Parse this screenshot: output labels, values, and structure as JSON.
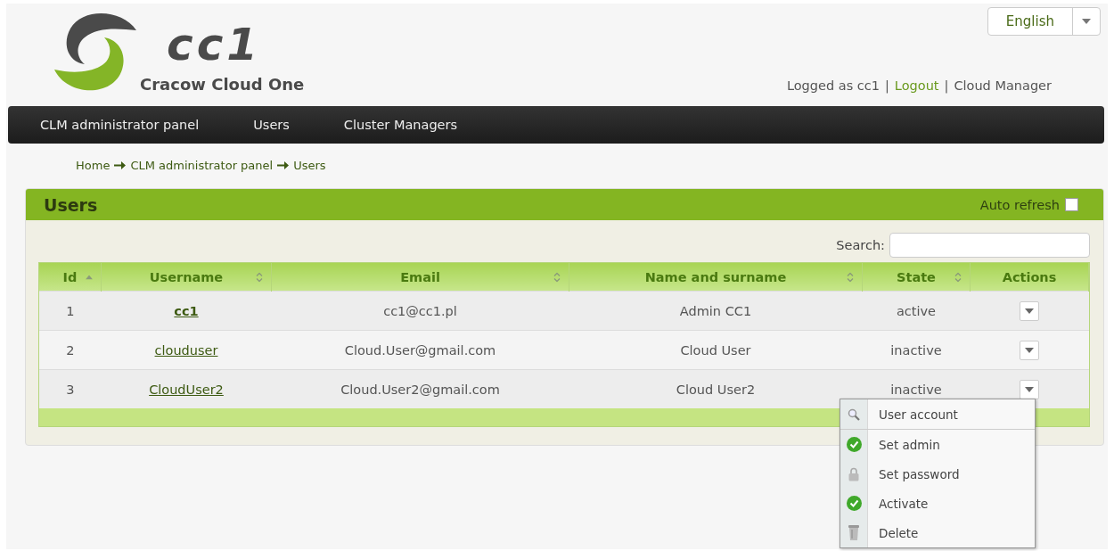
{
  "logo": {
    "name": "cc1",
    "tagline": "Cracow Cloud One"
  },
  "language": {
    "value": "English"
  },
  "user_bar": [
    {
      "text": "Logged as cc1",
      "kind": "text"
    },
    {
      "text": "|",
      "kind": "separator"
    },
    {
      "text": "Logout",
      "kind": "logout"
    },
    {
      "text": "|",
      "kind": "separator"
    },
    {
      "text": "Cloud Manager",
      "kind": "link"
    }
  ],
  "nav": [
    "CLM administrator panel",
    "Users",
    "Cluster Managers"
  ],
  "breadcrumb": [
    "Home",
    "CLM administrator panel",
    "Users"
  ],
  "panel": {
    "title": "Users",
    "auto_refresh": {
      "label": "Auto refresh",
      "checked": false
    }
  },
  "search": {
    "label": "Search:"
  },
  "table": {
    "columns": [
      {
        "label": "Id",
        "kind": "sorted"
      },
      {
        "label": "Username",
        "kind": "sortable"
      },
      {
        "label": "Email",
        "kind": "sortable"
      },
      {
        "label": "Name and surname",
        "kind": "sortable"
      },
      {
        "label": "State",
        "kind": "sortable"
      },
      {
        "label": "Actions",
        "kind": "plain"
      }
    ],
    "rows": [
      {
        "id": "1",
        "username": "cc1",
        "current": true,
        "email": "cc1@cc1.pl",
        "name": "Admin CC1",
        "state": "active"
      },
      {
        "id": "2",
        "username": "clouduser",
        "current": false,
        "email": "Cloud.User@gmail.com",
        "name": "Cloud User",
        "state": "inactive"
      },
      {
        "id": "3",
        "username": "CloudUser2",
        "current": false,
        "email": "Cloud.User2@gmail.com",
        "name": "Cloud User2",
        "state": "inactive"
      }
    ]
  },
  "menu": {
    "items": [
      {
        "label": "User account",
        "kind": "search",
        "divider_after": true
      },
      {
        "label": "Set admin",
        "kind": "check",
        "divider_after": false
      },
      {
        "label": "Set password",
        "kind": "lock",
        "divider_after": false
      },
      {
        "label": "Activate",
        "kind": "check",
        "divider_after": false
      },
      {
        "label": "Delete",
        "kind": "trash",
        "divider_after": false
      }
    ]
  }
}
